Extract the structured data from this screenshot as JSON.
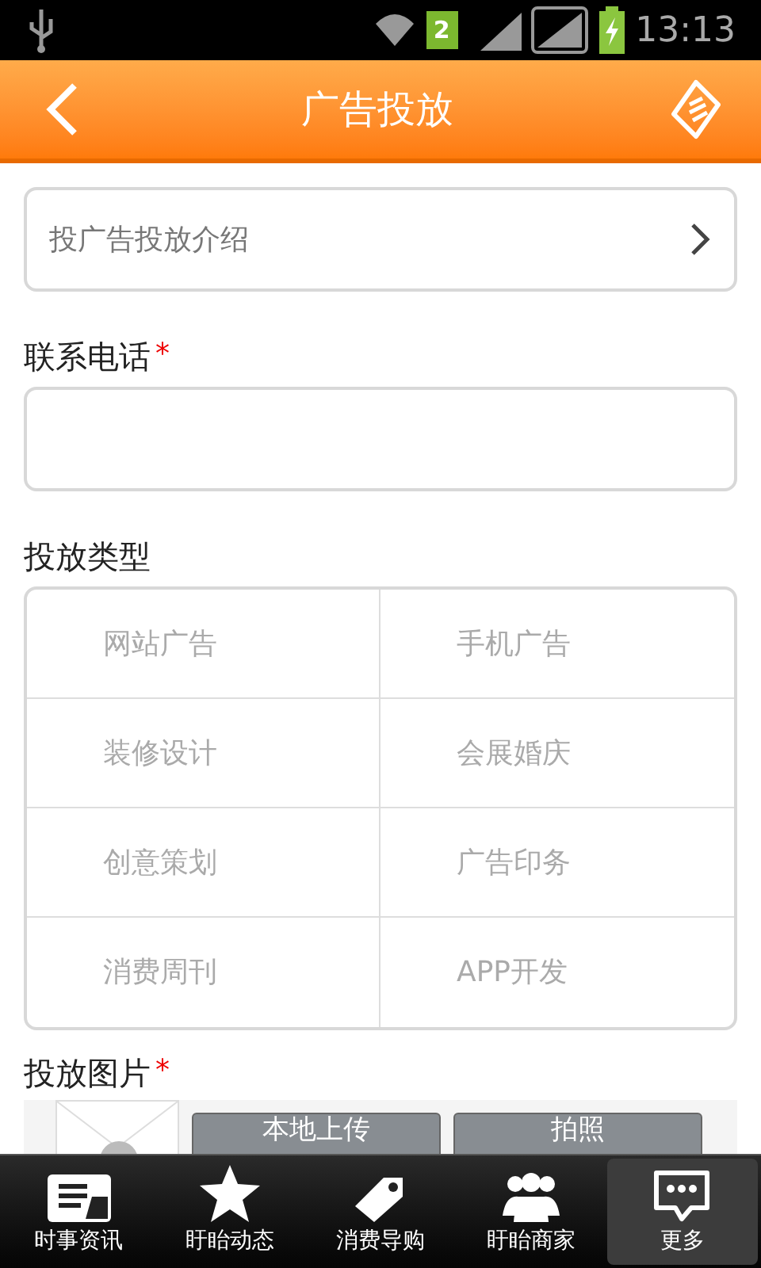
{
  "status_bar": {
    "sim_slot": "2",
    "time": "13:13"
  },
  "header": {
    "title": "广告投放"
  },
  "intro_link": {
    "label": "投广告投放介绍"
  },
  "phone": {
    "label": "联系电话",
    "required_mark": "*"
  },
  "ad_types": {
    "label": "投放类型",
    "options": [
      {
        "label": "网站广告",
        "selected": false
      },
      {
        "label": "手机广告",
        "selected": false
      },
      {
        "label": "装修设计",
        "selected": false
      },
      {
        "label": "会展婚庆",
        "selected": false
      },
      {
        "label": "创意策划",
        "selected": false
      },
      {
        "label": "广告印务",
        "selected": false
      },
      {
        "label": "消费周刊",
        "selected": false
      },
      {
        "label": "APP开发",
        "selected": false
      }
    ]
  },
  "images": {
    "label": "投放图片",
    "required_mark": "*",
    "buttons": [
      "本地上传",
      "拍照"
    ]
  },
  "tab_bar": [
    {
      "label": "时事资讯",
      "kind": "news",
      "selected": false
    },
    {
      "label": "盱眙动态",
      "kind": "star",
      "selected": false
    },
    {
      "label": "消费导购",
      "kind": "tag",
      "selected": false
    },
    {
      "label": "盱眙商家",
      "kind": "people",
      "selected": false
    },
    {
      "label": "更多",
      "kind": "more",
      "selected": true
    }
  ]
}
